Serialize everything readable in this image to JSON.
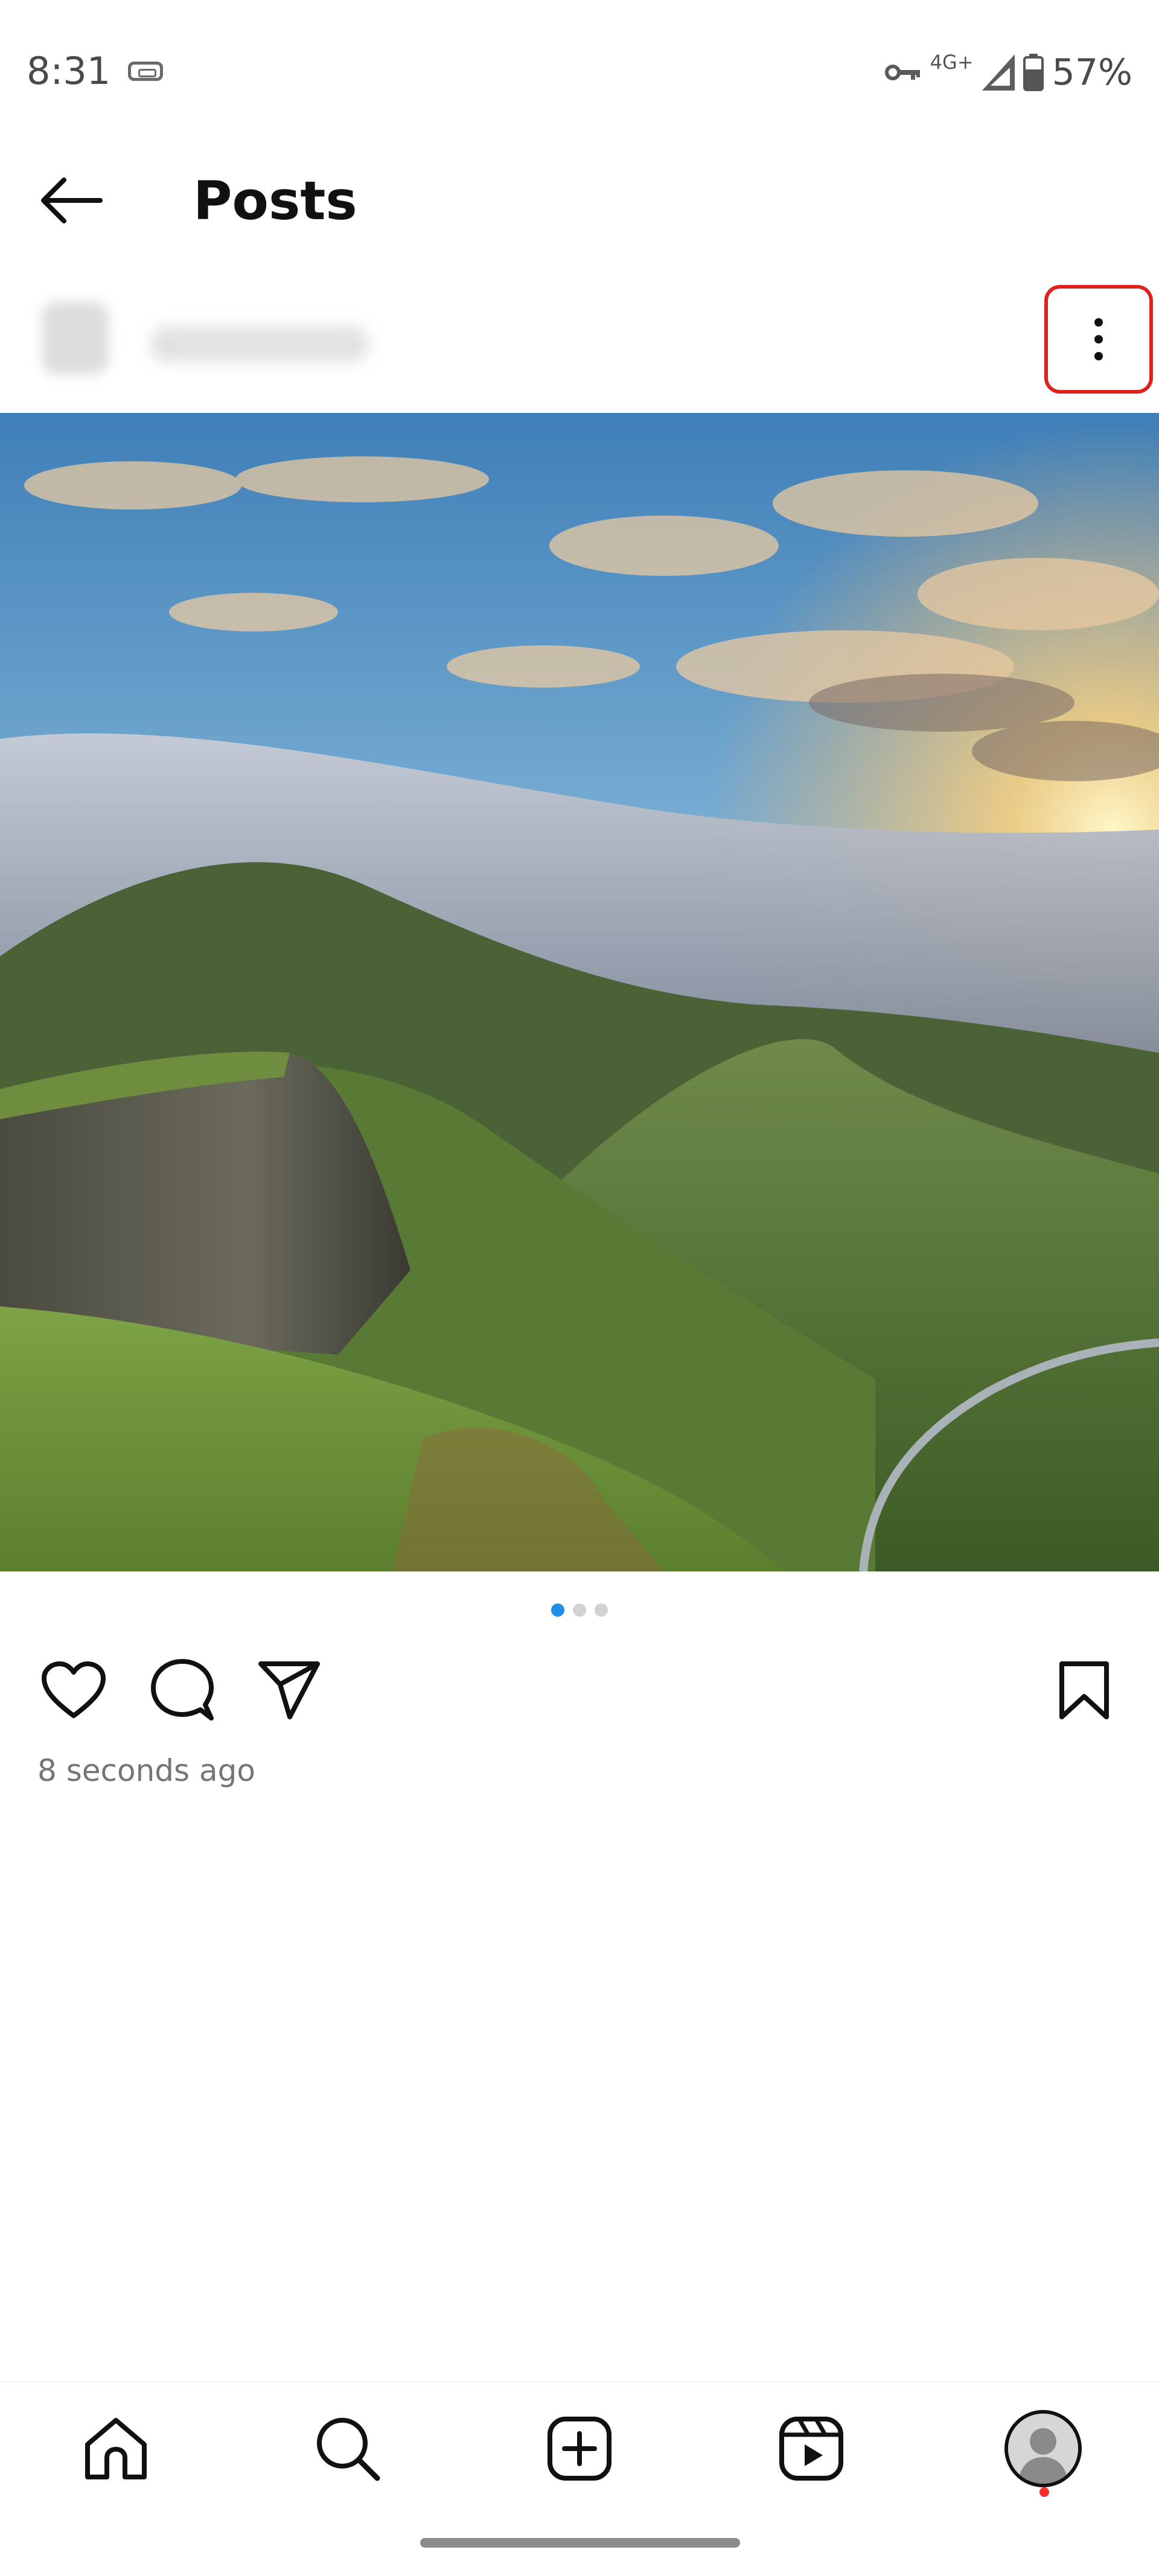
{
  "status_bar": {
    "time": "8:31",
    "network": "4G+",
    "battery": "57%"
  },
  "header": {
    "title": "Posts",
    "back_icon": "arrow-left-icon"
  },
  "post": {
    "more_icon": "more-vertical-icon",
    "carousel": {
      "count": 3,
      "active_index": 0
    },
    "timestamp": "8 seconds ago",
    "actions": [
      "heart-icon",
      "comment-icon",
      "share-icon",
      "bookmark-icon"
    ]
  },
  "bottom_nav": {
    "items": [
      "home-icon",
      "search-icon",
      "create-icon",
      "reels-icon",
      "profile-avatar"
    ]
  },
  "colors": {
    "accent_blue": "#1f8fe8",
    "highlight_red": "#e0201d",
    "notification_dot": "#ff2b2b"
  }
}
